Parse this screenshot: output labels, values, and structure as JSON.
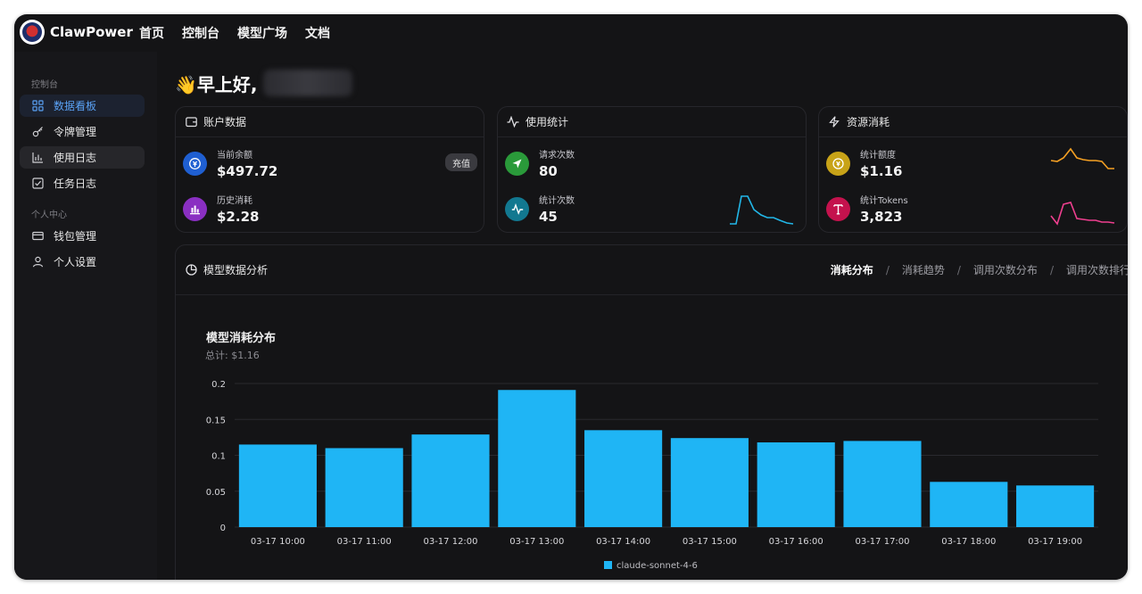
{
  "app": {
    "brand": "ClawPower",
    "nav": [
      "首页",
      "控制台",
      "模型广场",
      "文档"
    ]
  },
  "sidebar": {
    "section1": "控制台",
    "items1": [
      {
        "label": "数据看板",
        "icon": "dashboard-icon"
      },
      {
        "label": "令牌管理",
        "icon": "key-icon"
      },
      {
        "label": "使用日志",
        "icon": "bar-chart-icon"
      },
      {
        "label": "任务日志",
        "icon": "checkbox-icon"
      }
    ],
    "section2": "个人中心",
    "items2": [
      {
        "label": "钱包管理",
        "icon": "wallet-icon"
      },
      {
        "label": "个人设置",
        "icon": "user-icon"
      }
    ]
  },
  "greeting": "👋早上好,",
  "account": {
    "title": "账户数据",
    "balance_label": "当前余额",
    "balance_value": "$497.72",
    "recharge": "充值",
    "history_label": "历史消耗",
    "history_value": "$2.28"
  },
  "usage": {
    "title": "使用统计",
    "requests_label": "请求次数",
    "requests_value": "80",
    "count_label": "统计次数",
    "count_value": "45"
  },
  "resource": {
    "title": "资源消耗",
    "quota_label": "统计额度",
    "quota_value": "$1.16",
    "tokens_label": "统计Tokens",
    "tokens_value": "3,823"
  },
  "analysis": {
    "title": "模型数据分析",
    "tabs": [
      "消耗分布",
      "消耗趋势",
      "调用次数分布",
      "调用次数排行"
    ],
    "active_tab": 0,
    "separator": "/"
  },
  "colors": {
    "bar": "#1fb5f5",
    "spark_cyan": "#22b7e8",
    "spark_orange": "#f5a023",
    "spark_pink": "#ef3f8f"
  },
  "chart_data": {
    "type": "bar",
    "title": "模型消耗分布",
    "subtitle": "总计:  $1.16",
    "categories": [
      "03-17 10:00",
      "03-17 11:00",
      "03-17 12:00",
      "03-17 13:00",
      "03-17 14:00",
      "03-17 15:00",
      "03-17 16:00",
      "03-17 17:00",
      "03-17 18:00",
      "03-17 19:00"
    ],
    "series": [
      {
        "name": "claude-sonnet-4-6",
        "values": [
          0.115,
          0.11,
          0.129,
          0.191,
          0.135,
          0.124,
          0.118,
          0.12,
          0.063,
          0.058
        ]
      }
    ],
    "yticks": [
      "0",
      "0.05",
      "0.1",
      "0.15",
      "0.2"
    ],
    "ylim": [
      0,
      0.2
    ],
    "grid": true,
    "legend": "bottom-center"
  }
}
